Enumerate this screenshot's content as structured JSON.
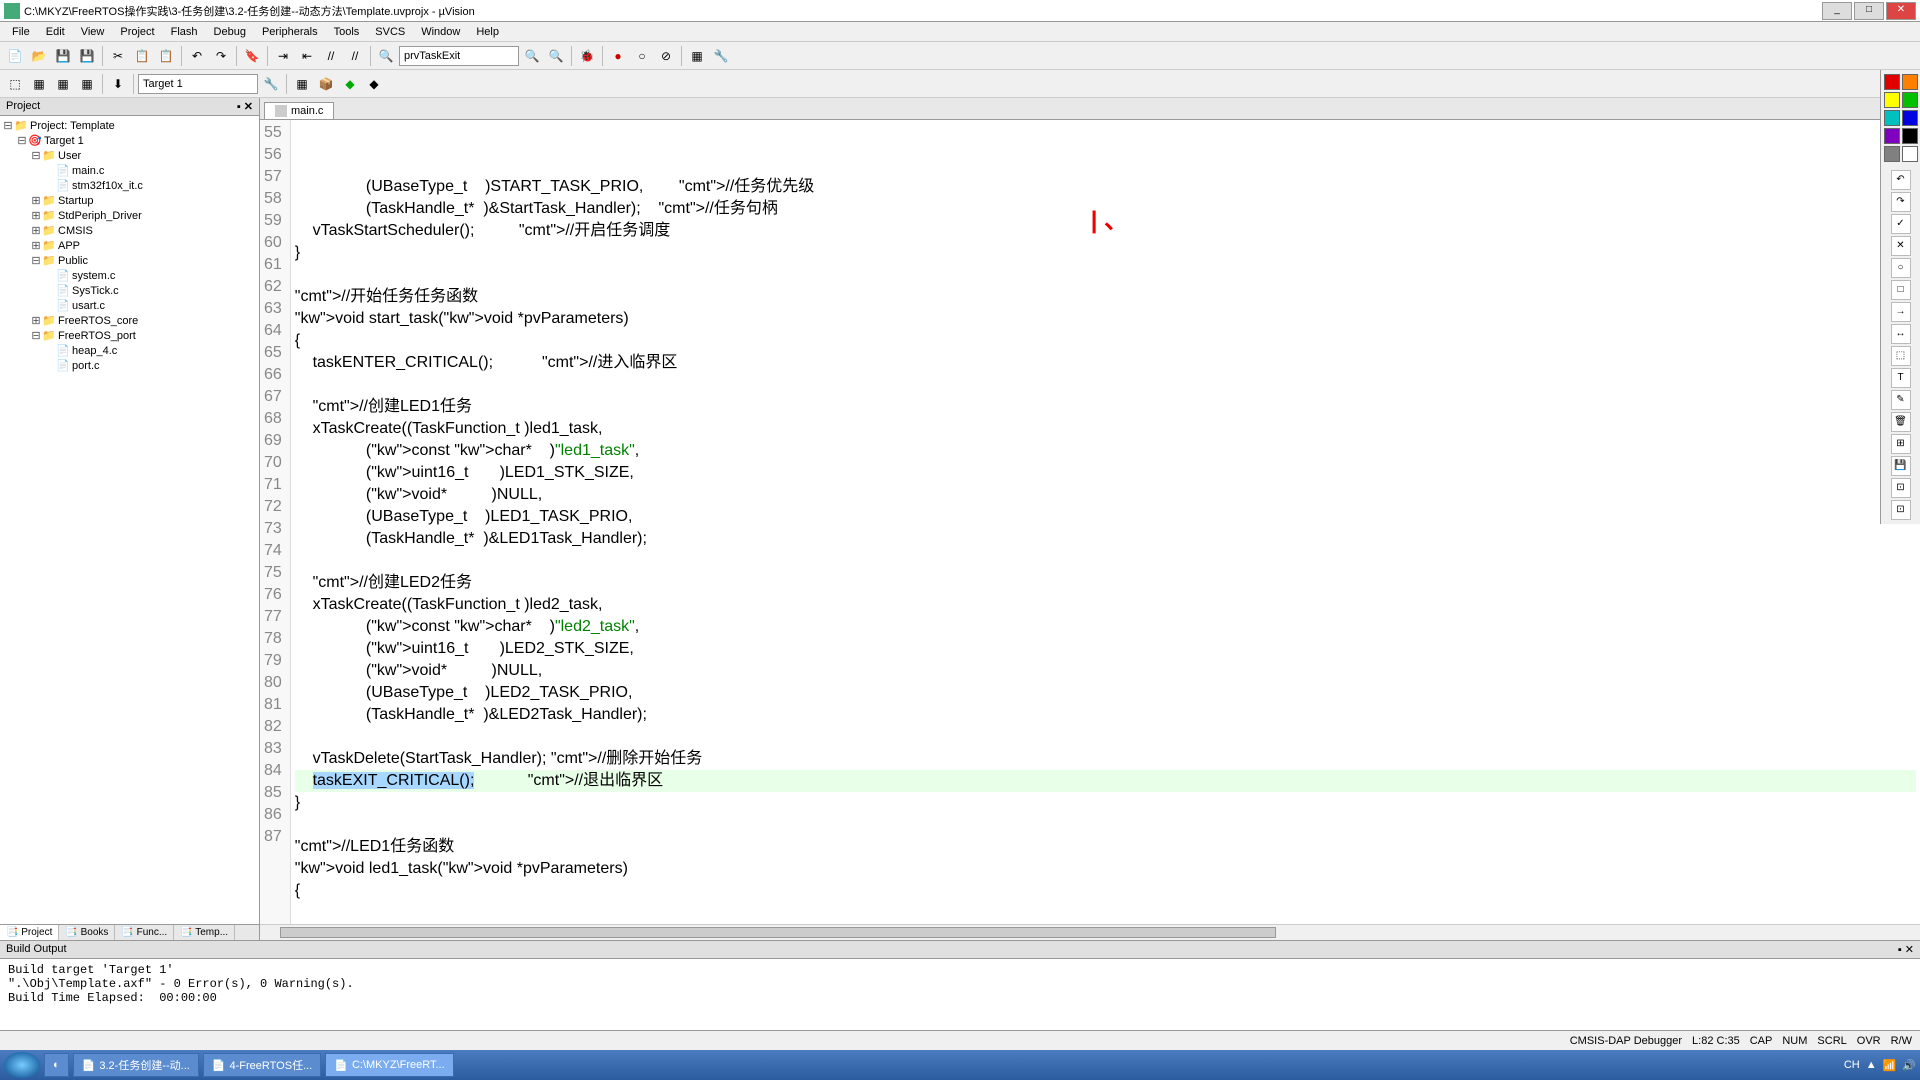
{
  "window": {
    "title": "C:\\MKYZ\\FreeRTOS操作实践\\3-任务创建\\3.2-任务创建--动态方法\\Template.uvprojx - µVision"
  },
  "menus": [
    "File",
    "Edit",
    "View",
    "Project",
    "Flash",
    "Debug",
    "Peripherals",
    "Tools",
    "SVCS",
    "Window",
    "Help"
  ],
  "toolbar_combo1": "prvTaskExit",
  "toolbar_combo2": "Target 1",
  "project_panel": {
    "title": "Project",
    "root": "Project: Template",
    "target": "Target 1",
    "groups": [
      {
        "name": "User",
        "files": [
          "main.c",
          "stm32f10x_it.c"
        ],
        "expanded": true
      },
      {
        "name": "Startup",
        "files": [],
        "expanded": false
      },
      {
        "name": "StdPeriph_Driver",
        "files": [],
        "expanded": false
      },
      {
        "name": "CMSIS",
        "files": [],
        "expanded": false
      },
      {
        "name": "APP",
        "files": [],
        "expanded": false
      },
      {
        "name": "Public",
        "files": [
          "system.c",
          "SysTick.c",
          "usart.c"
        ],
        "expanded": true
      },
      {
        "name": "FreeRTOS_core",
        "files": [],
        "expanded": false
      },
      {
        "name": "FreeRTOS_port",
        "files": [
          "heap_4.c",
          "port.c"
        ],
        "expanded": true
      }
    ],
    "tabs": [
      "Project",
      "Books",
      "Func...",
      "Temp..."
    ]
  },
  "editor": {
    "tab": "main.c",
    "first_line": 55,
    "lines": [
      "                (UBaseType_t    )START_TASK_PRIO,        //任务优先级",
      "                (TaskHandle_t*  )&StartTask_Handler);    //任务句柄",
      "    vTaskStartScheduler();          //开启任务调度",
      "}",
      "",
      "//开始任务任务函数",
      "void start_task(void *pvParameters)",
      "{",
      "    taskENTER_CRITICAL();           //进入临界区",
      "",
      "    //创建LED1任务",
      "    xTaskCreate((TaskFunction_t )led1_task,",
      "                (const char*    )\"led1_task\",",
      "                (uint16_t       )LED1_STK_SIZE,",
      "                (void*          )NULL,",
      "                (UBaseType_t    )LED1_TASK_PRIO,",
      "                (TaskHandle_t*  )&LED1Task_Handler);",
      "",
      "    //创建LED2任务",
      "    xTaskCreate((TaskFunction_t )led2_task,",
      "                (const char*    )\"led2_task\",",
      "                (uint16_t       )LED2_STK_SIZE,",
      "                (void*          )NULL,",
      "                (UBaseType_t    )LED2_TASK_PRIO,",
      "                (TaskHandle_t*  )&LED2Task_Handler);",
      "",
      "    vTaskDelete(StartTask_Handler); //删除开始任务",
      "    taskEXIT_CRITICAL();            //退出临界区",
      "}",
      "",
      "//LED1任务函数",
      "void led1_task(void *pvParameters)",
      "{"
    ],
    "selected_line_index": 27,
    "selected_text": "taskEXIT_CRITICAL();"
  },
  "build_output": {
    "title": "Build Output",
    "text": "Build target 'Target 1'\n\".\\Obj\\Template.axf\" - 0 Error(s), 0 Warning(s).\nBuild Time Elapsed:  00:00:00"
  },
  "status": {
    "debugger": "CMSIS-DAP Debugger",
    "pos": "L:82 C:35",
    "caps": "CAP",
    "num": "NUM",
    "scrl": "SCRL",
    "ovr": "OVR",
    "rw": "R/W"
  },
  "taskbar": {
    "items": [
      "3.2-任务创建--动...",
      "4-FreeRTOS任...",
      "C:\\MKYZ\\FreeRT..."
    ],
    "time": "",
    "ime": "CH"
  },
  "colors": [
    "#e00000",
    "#ff8000",
    "#ffff00",
    "#00c000",
    "#00c0c0",
    "#0000e0",
    "#8000c0",
    "#000000",
    "#808080",
    "#ffffff"
  ]
}
